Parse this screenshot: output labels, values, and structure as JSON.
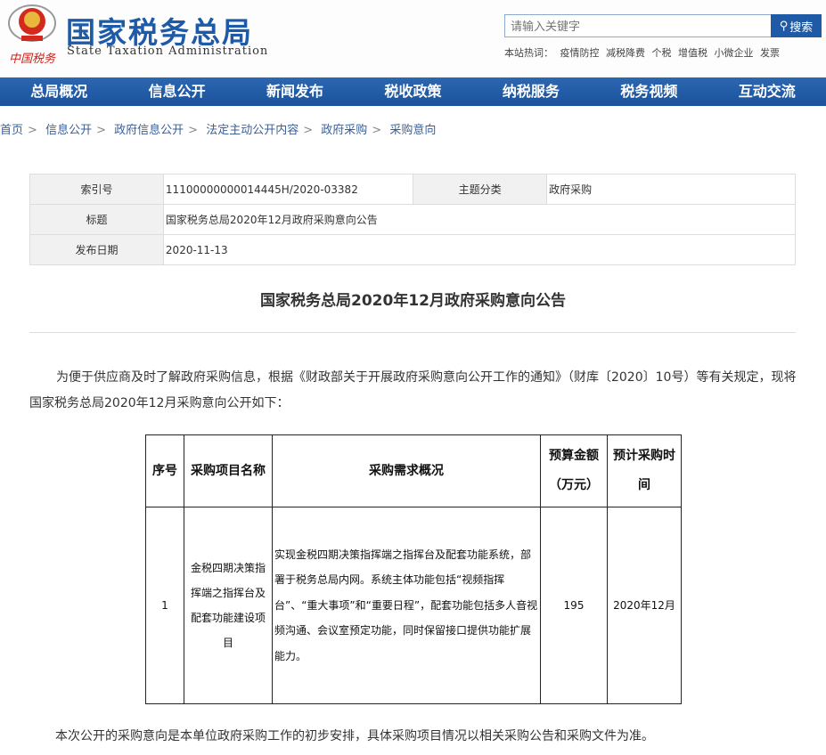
{
  "header": {
    "brand_cn": "国家税务总局",
    "brand_en": "State Taxation Administration",
    "brand_sig": "中国税务",
    "search_placeholder": "请输入关键字",
    "search_button": "搜索",
    "hot_label": "本站热词：",
    "hot_words": [
      "疫情防控",
      "减税降费",
      "个税",
      "增值税",
      "小微企业",
      "发票"
    ]
  },
  "nav": [
    "总局概况",
    "信息公开",
    "新闻发布",
    "税收政策",
    "纳税服务",
    "税务视频",
    "互动交流"
  ],
  "breadcrumb": [
    "首页",
    "信息公开",
    "政府信息公开",
    "法定主动公开内容",
    "政府采购",
    "采购意向"
  ],
  "info": {
    "index_label": "索引号",
    "index_value": "11100000000014445H/2020-03382",
    "topic_label": "主题分类",
    "topic_value": "政府采购",
    "title_label": "标题",
    "title_value": "国家税务总局2020年12月政府采购意向公告",
    "date_label": "发布日期",
    "date_value": "2020-11-13"
  },
  "article": {
    "title": "国家税务总局2020年12月政府采购意向公告",
    "intro": "为便于供应商及时了解政府采购信息，根据《财政部关于开展政府采购意向公开工作的通知》（财库〔2020〕10号）等有关规定，现将国家税务总局2020年12月采购意向公开如下：",
    "table": {
      "headers": [
        "序号",
        "采购项目名称",
        "采购需求概况",
        "预算金额（万元）",
        "预计采购时间"
      ],
      "rows": [
        {
          "no": "1",
          "name": "金税四期决策指挥端之指挥台及配套功能建设项目",
          "req": "实现金税四期决策指挥端之指挥台及配套功能系统，部署于税务总局内网。系统主体功能包括“视频指挥台”、“重大事项”和“重要日程”，配套功能包括多人音视频沟通、会议室预定功能，同时保留接口提供功能扩展能力。",
          "budget": "195",
          "time": "2020年12月"
        }
      ]
    },
    "footer": "本次公开的采购意向是本单位政府采购工作的初步安排，具体采购项目情况以相关采购公告和采购文件为准。"
  },
  "colors": {
    "brand_blue": "#1d5aa8",
    "nav_blue": "#1f5aa6"
  }
}
